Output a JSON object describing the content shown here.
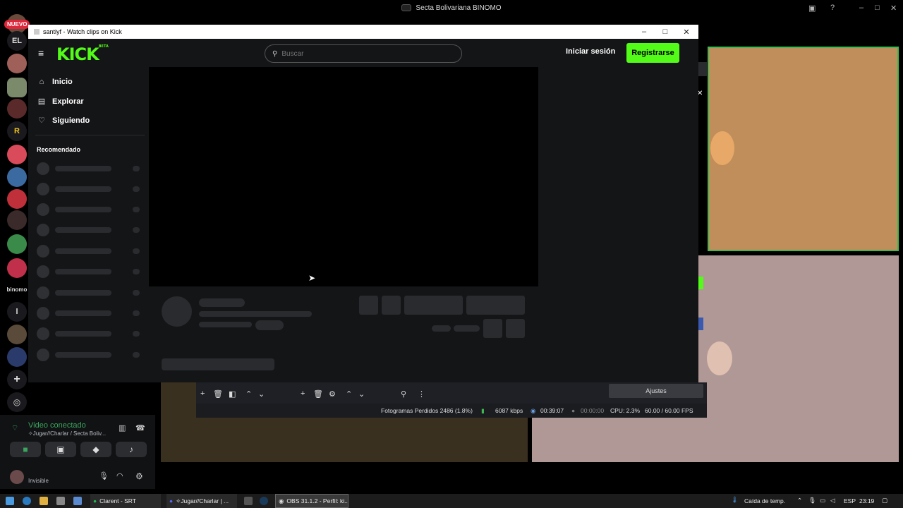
{
  "discord_top": {
    "title": "Secta Bolivariana BINOMO"
  },
  "discord_rail": {
    "new_badge": "NUEVO",
    "el_label": "EL",
    "r_label": "R",
    "l_label": "l",
    "binomo_label": "binomo"
  },
  "voice_panel": {
    "status": "Video conectado",
    "channel": "✧Jugar//Charlar / Secta Boliv...",
    "user_status": "Invisible"
  },
  "kick_window": {
    "title": "santiyf - Watch clips on Kick",
    "logo": "KICK",
    "logo_beta": "BETA",
    "search_placeholder": "Buscar",
    "login": "Iniciar sesión",
    "register": "Registrarse",
    "nav": [
      {
        "label": "Inicio",
        "icon": "home-icon"
      },
      {
        "label": "Explorar",
        "icon": "browse-icon"
      },
      {
        "label": "Siguiendo",
        "icon": "heart-icon"
      }
    ],
    "recommended_heading": "Recomendado"
  },
  "obs": {
    "settings_button": "Ajustes",
    "dropped_frames": "Fotogramas Perdidos 2486 (1.8%)",
    "bitrate": "6087 kbps",
    "stream_time": "00:39:07",
    "rec_time": "00:00:00",
    "cpu": "CPU: 2.3%",
    "fps": "60.00 / 60.00 FPS"
  },
  "taskbar": {
    "item_spotify": "Clarent - SRT",
    "item_discord": "✧Jugar//Charlar | ...",
    "item_obs": "OBS 31.1.2 - Perfil: ki...",
    "weather": "Caída de temp.",
    "lang": "ESP",
    "clock": "23:19"
  },
  "colors": {
    "kick_green": "#53fc18",
    "voice_green": "#3ba55d",
    "border_green": "#3fb950"
  }
}
